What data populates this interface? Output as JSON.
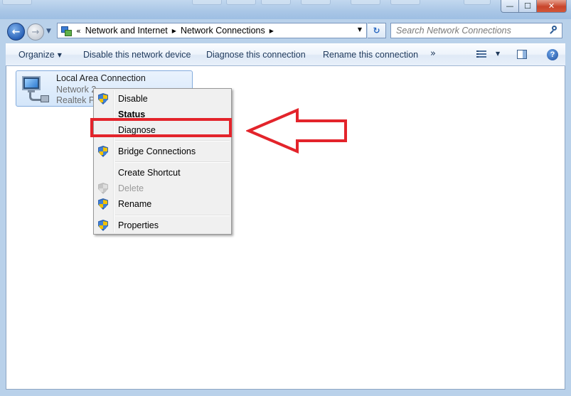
{
  "window": {
    "minimize_glyph": "—",
    "maximize_glyph": "☐",
    "close_glyph": "✕"
  },
  "nav": {
    "back_glyph": "←",
    "forward_glyph": "→",
    "recent_glyph": "▼"
  },
  "address": {
    "overflow_glyph": "«",
    "crumbs": [
      "Network and Internet",
      "Network Connections"
    ],
    "separator_glyph": "▶",
    "dropdown_glyph": "▼",
    "refresh_glyph": "↻"
  },
  "search": {
    "placeholder": "Search Network Connections"
  },
  "toolbar": {
    "organize": "Organize",
    "disable_device": "Disable this network device",
    "diagnose": "Diagnose this connection",
    "rename": "Rename this connection",
    "more": "»",
    "caret": "▼",
    "help": "?"
  },
  "connection": {
    "name": "Local Area Connection",
    "network": "Network  2",
    "adapter": "Realtek PC"
  },
  "context_menu": {
    "items": [
      {
        "label": "Disable",
        "shield": true,
        "bold": false,
        "disabled": false
      },
      {
        "label": "Status",
        "shield": false,
        "bold": true,
        "disabled": false
      },
      {
        "label": "Diagnose",
        "shield": false,
        "bold": false,
        "disabled": false
      },
      {
        "label": "Bridge Connections",
        "shield": true,
        "bold": false,
        "disabled": false
      },
      {
        "label": "Create Shortcut",
        "shield": false,
        "bold": false,
        "disabled": false
      },
      {
        "label": "Delete",
        "shield": true,
        "bold": false,
        "disabled": true
      },
      {
        "label": "Rename",
        "shield": true,
        "bold": false,
        "disabled": false
      },
      {
        "label": "Properties",
        "shield": true,
        "bold": false,
        "disabled": false
      }
    ]
  },
  "colors": {
    "highlight": "#e3242b",
    "frame": "#b9d1ea",
    "toolbar_text": "#1e395b"
  }
}
